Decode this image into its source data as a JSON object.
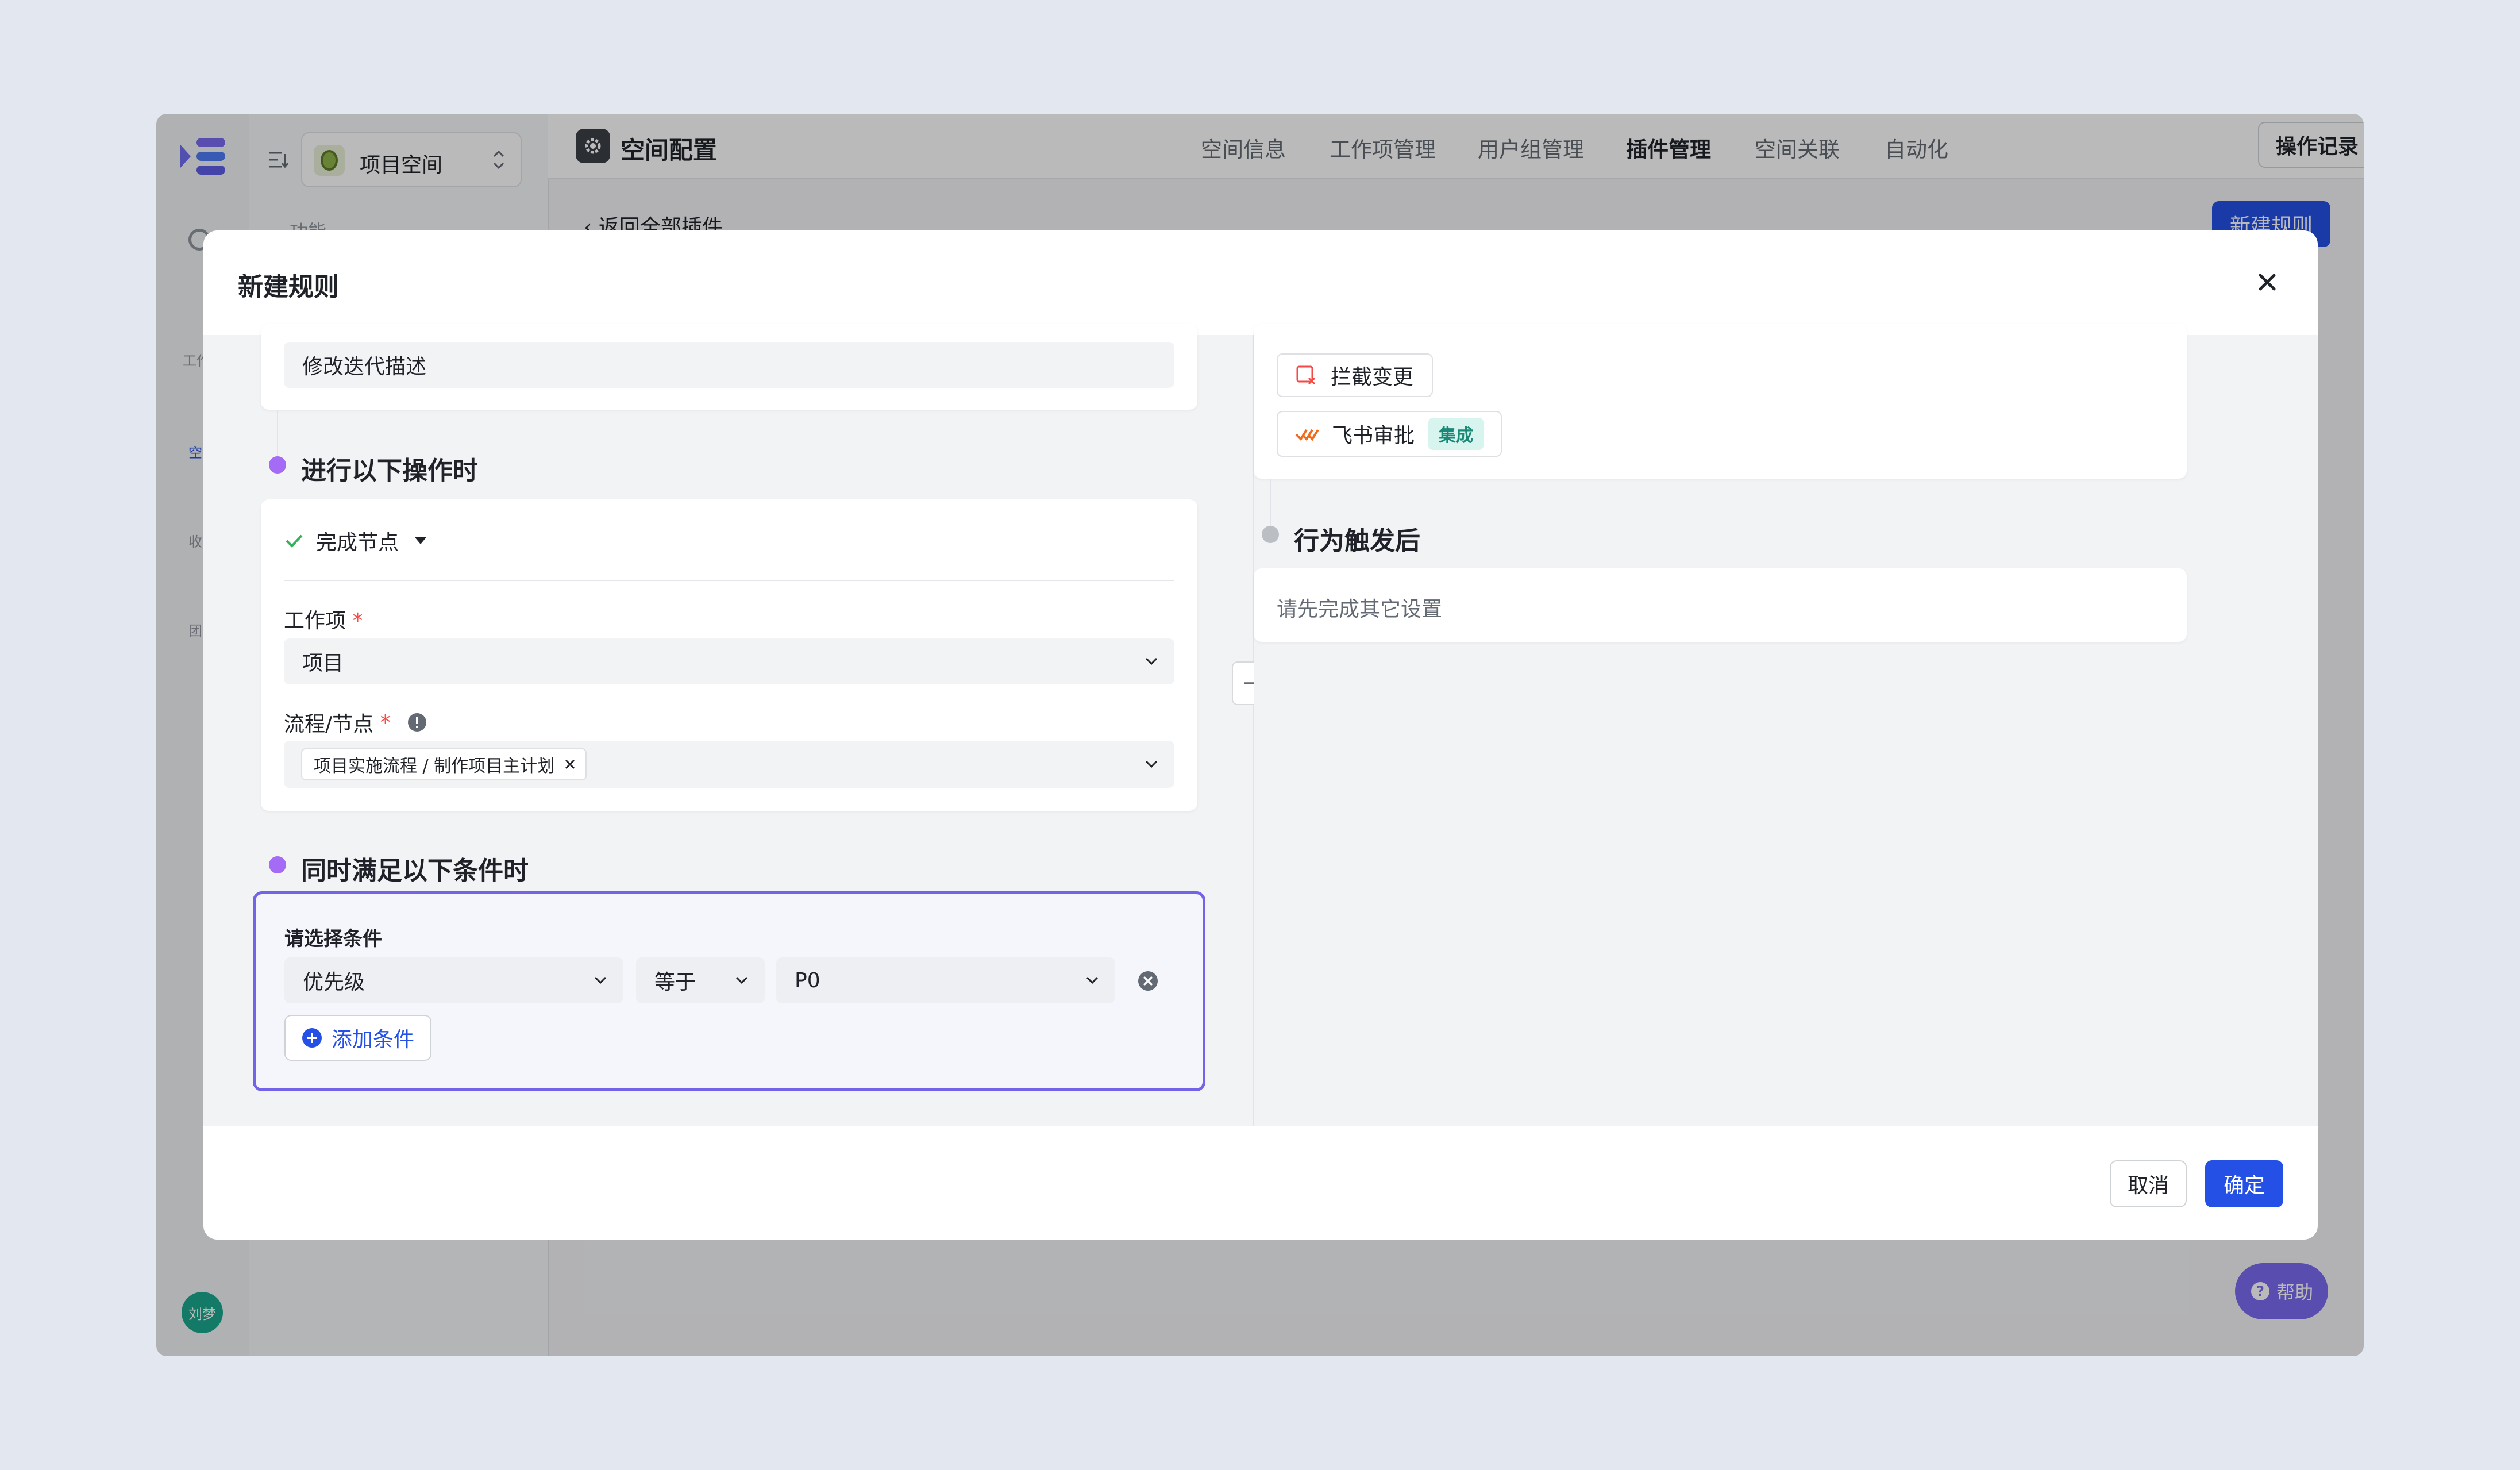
{
  "app": {
    "space_selector": "项目空间",
    "sidebar_section_label": "功能",
    "rail_labels": [
      "工作",
      "空",
      "收",
      "团"
    ],
    "user_avatar": "刘梦",
    "page_title": "空间配置",
    "tabs": [
      {
        "label": "空间信息"
      },
      {
        "label": "工作项管理"
      },
      {
        "label": "用户组管理"
      },
      {
        "label": "插件管理",
        "active": true
      },
      {
        "label": "空间关联"
      },
      {
        "label": "自动化"
      }
    ],
    "operation_log_button": "操作记录",
    "new_button": "新建",
    "back_link": "返回全部插件",
    "new_rule_button": "新建规则",
    "help_button": "帮助"
  },
  "modal": {
    "title": "新建规则",
    "left": {
      "top_item": "修改迭代描述",
      "section_action_title": "进行以下操作时",
      "action_select": "完成节点",
      "workitem_label": "工作项",
      "workitem_value": "项目",
      "flow_label": "流程/节点",
      "flow_tag": "项目实施流程 / 制作项目主计划",
      "section_condition_title": "同时满足以下条件时",
      "condition_label": "请选择条件",
      "condition_field": "优先级",
      "condition_operator": "等于",
      "condition_value": "P0",
      "add_condition": "添加条件"
    },
    "right": {
      "option_intercept": "拦截变更",
      "option_feishu": "飞书审批",
      "feishu_badge": "集成",
      "section_after_title": "行为触发后",
      "after_placeholder": "请先完成其它设置"
    },
    "cancel_button": "取消",
    "confirm_button": "确定"
  },
  "colors": {
    "brand": "#2450e6",
    "purple_dot": "#a46cf5",
    "gray_dot": "#bbbfc4",
    "teal_badge_bg": "#d7f4ef",
    "teal_badge_text": "#1a8a77"
  },
  "icons": [
    "logo-icon",
    "sort-icon",
    "avocado-icon",
    "updown-icon",
    "gear-icon",
    "plus-circle-icon",
    "close-icon",
    "check-icon",
    "caret-down-icon",
    "chevron-down-icon",
    "info-icon",
    "tag-close-icon",
    "clear-circle-icon",
    "arrow-right-icon",
    "intercept-icon",
    "feishu-icon",
    "help-icon"
  ]
}
